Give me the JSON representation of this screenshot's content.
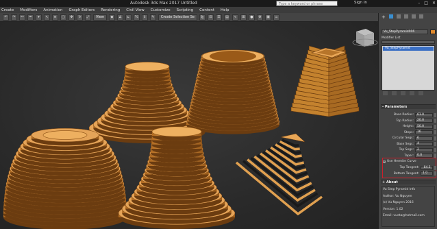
{
  "titlebar": {
    "title": "Autodesk 3ds Max 2017    Untitled",
    "search_placeholder": "Type a keyword or phrase",
    "signin": "Sign In",
    "minimize": "–",
    "maximize": "□",
    "close": "✕"
  },
  "menu": {
    "items": [
      "Create",
      "Modifiers",
      "Animation",
      "Graph Editors",
      "Rendering",
      "Civil View",
      "Customize",
      "Scripting",
      "Content",
      "Help"
    ]
  },
  "toolbar": {
    "view_dropdown": "View",
    "selection_set": "Create Selection Se"
  },
  "command_panel": {
    "object_name": "Vu_StepPyramid006",
    "object_color": "#e08a2e",
    "modifier_list_label": "Modifier List",
    "stack_item": "Vu_StepPyramid",
    "parameters_title": "Parameters",
    "params": [
      {
        "label": "Base Radius:",
        "value": "61.0"
      },
      {
        "label": "Top Radius:",
        "value": "20.0"
      },
      {
        "label": "Height:",
        "value": "50.0"
      },
      {
        "label": "Steps:",
        "value": "16"
      },
      {
        "label": "Circular Segs:",
        "value": "6"
      },
      {
        "label": "Base Segs:",
        "value": "4"
      },
      {
        "label": "Top Segs:",
        "value": "2"
      },
      {
        "label": "Taper:",
        "value": "0.0"
      }
    ],
    "hermite_checkbox_label": "Use Hermite Curve",
    "hermite_checked": true,
    "hermite_params": [
      {
        "label": "Top Tangent:",
        "value": "-84.5"
      },
      {
        "label": "Bottom Tangent:",
        "value": "1.0"
      }
    ],
    "about_title": "About",
    "about_lines": [
      "Vu Step Pyramid Info",
      "Author: Vu Nguyen",
      "(c) Vu Nguyen 2016",
      "Version: 1.02",
      "Email: vueta@hotmail.com"
    ],
    "highlight_color": "#cc1f2b"
  },
  "scene": {
    "object_color": "#e0a050",
    "shapes": [
      "stepped-cone",
      "stepped-bowl-cone",
      "stepped-box-pyramid",
      "stepped-dome",
      "stepped-bell",
      "stepped-triangle-pyramid"
    ]
  }
}
